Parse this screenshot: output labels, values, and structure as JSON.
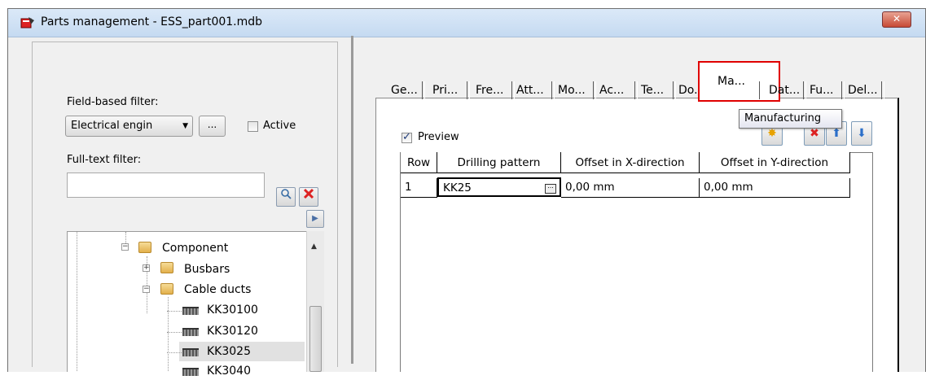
{
  "window": {
    "title": "Parts management - ESS_part001.mdb",
    "close_label": "✕"
  },
  "left": {
    "field_filter_label": "Field-based filter:",
    "field_filter_value": "Electrical engin",
    "dots_label": "...",
    "active_label": "Active",
    "active_checked": false,
    "fulltext_label": "Full-text filter:",
    "fulltext_value": ""
  },
  "tree": {
    "items": [
      {
        "label": "Component"
      },
      {
        "label": "Busbars"
      },
      {
        "label": "Cable ducts"
      },
      {
        "label": "KK30100"
      },
      {
        "label": "KK30120"
      },
      {
        "label": "KK3025"
      },
      {
        "label": "KK3040"
      }
    ]
  },
  "tabs": [
    {
      "label": "Ge..."
    },
    {
      "label": "Pri..."
    },
    {
      "label": "Fre..."
    },
    {
      "label": "Att..."
    },
    {
      "label": "Mo..."
    },
    {
      "label": "Ac..."
    },
    {
      "label": "Te..."
    },
    {
      "label": "Do..."
    },
    {
      "label": "Ma..."
    },
    {
      "label": "Dat..."
    },
    {
      "label": "Fu..."
    },
    {
      "label": "Del..."
    }
  ],
  "tooltip": "Manufacturing",
  "preview": {
    "label": "Preview",
    "checked": true
  },
  "table": {
    "headers": [
      "Row",
      "Drilling pattern",
      "Offset in X-direction",
      "Offset in Y-direction"
    ],
    "rows": [
      [
        "1",
        "KK25",
        "0,00 mm",
        "0,00 mm"
      ]
    ]
  }
}
